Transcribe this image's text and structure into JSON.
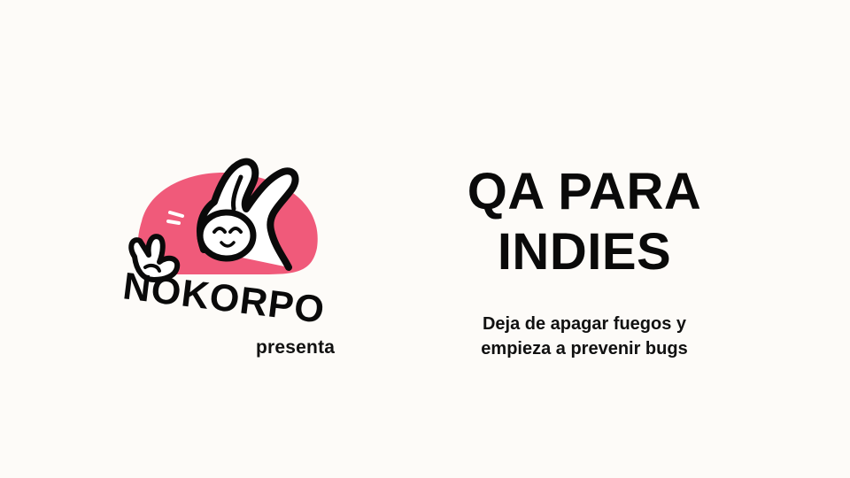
{
  "slide": {
    "brand_name": "NOKORPO",
    "presents_label": "presenta",
    "title_line1": "QA PARA",
    "title_line2": "INDIES",
    "subtitle_line1": "Deja de apagar fuegos y",
    "subtitle_line2": "empieza a prevenir bugs"
  },
  "colors": {
    "background": "#fdfbf8",
    "accent": "#f05a7a",
    "ink": "#0a0a0a"
  },
  "icons": {
    "logo": "bunny-peace-sign-logo"
  }
}
